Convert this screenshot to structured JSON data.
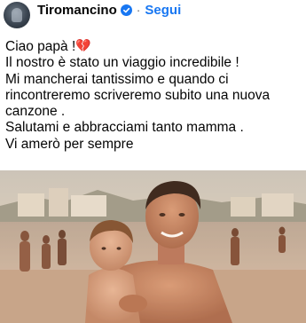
{
  "header": {
    "page_name": "Tiromancino",
    "separator": "·",
    "follow_label": "Segui",
    "verified_icon": "verified-badge-icon",
    "accent_color": "#1877f2"
  },
  "post": {
    "lines": [
      "Ciao papà !",
      "Il nostro è stato un viaggio incredibile !",
      "Mi mancherai tantissimo e quando ci",
      "rincontreremo scriveremo subito una nuova",
      "canzone .",
      "Salutami  e abbracciami tanto mamma .",
      "Vi amerò per sempre"
    ],
    "emoji": "💔",
    "emoji_icon": "broken-heart-icon"
  },
  "photo": {
    "subject": "vintage-beach-photo"
  }
}
